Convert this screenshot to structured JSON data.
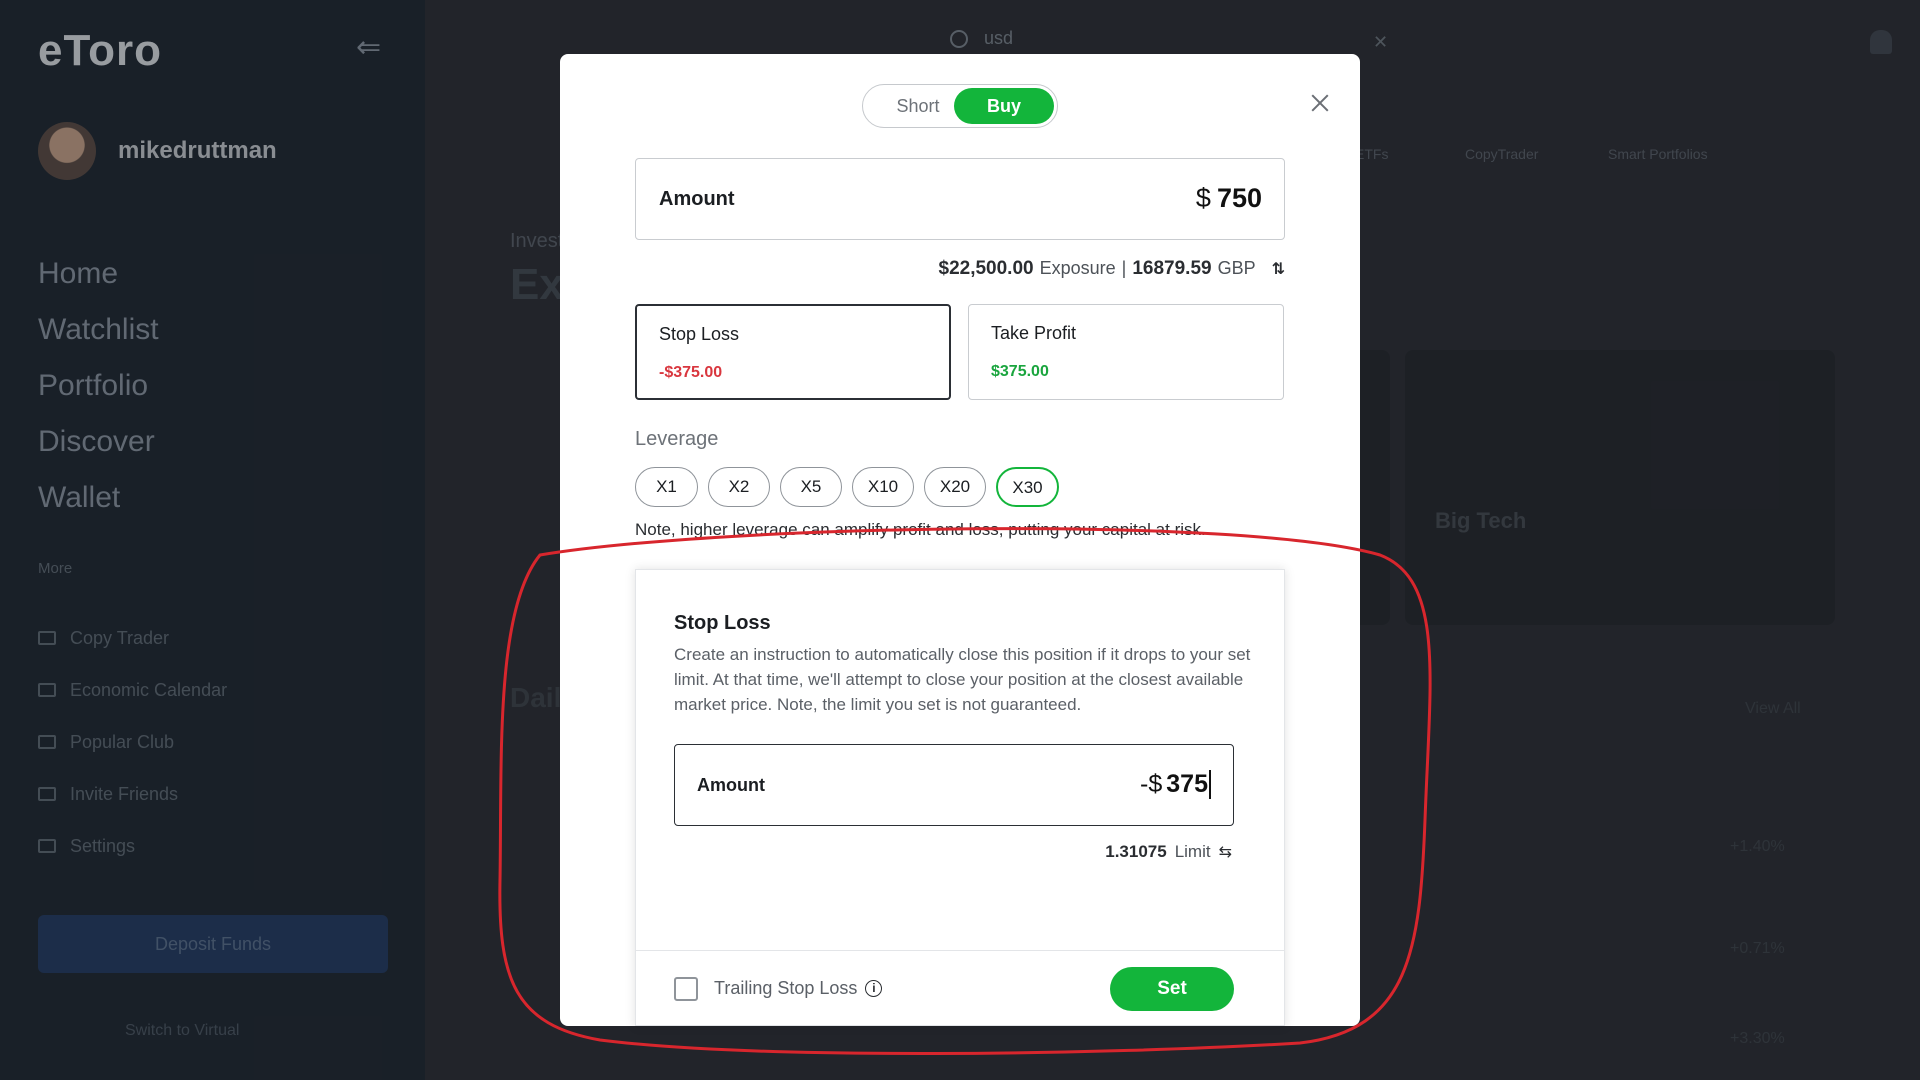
{
  "app": {
    "logo": "eToro",
    "username": "mikedruttman",
    "nav": [
      "Home",
      "Watchlist",
      "Portfolio",
      "Discover",
      "Wallet"
    ],
    "more_label": "More",
    "sub_nav": [
      "Copy Trader",
      "Economic Calendar",
      "Popular Club",
      "Invite Friends",
      "Settings"
    ],
    "deposit_label": "Deposit Funds",
    "footer_label": "Switch to Virtual",
    "search_value": "usd",
    "tabs": [
      "ETFs",
      "CopyTrader",
      "Smart Portfolios"
    ],
    "heading_small": "Investing",
    "heading": "Ex",
    "card_label": "Big Tech",
    "section_label": "Daily",
    "view_all": "View All",
    "row_values": [
      "+1.40%",
      "+0.71%",
      "+3.30%"
    ]
  },
  "trade": {
    "toggle": {
      "short": "Short",
      "buy": "Buy",
      "selected": "Buy"
    },
    "amount": {
      "label": "Amount",
      "currency": "$",
      "value": "750"
    },
    "exposure": {
      "value": "$22,500.00",
      "label": "Exposure",
      "separator": "|",
      "alt_value": "16879.59",
      "alt_currency": "GBP"
    },
    "stop_loss": {
      "label": "Stop Loss",
      "value": "-$375.00"
    },
    "take_profit": {
      "label": "Take Profit",
      "value": "$375.00"
    },
    "leverage": {
      "label": "Leverage",
      "options": [
        "X1",
        "X2",
        "X5",
        "X10",
        "X20",
        "X30"
      ],
      "selected": "X30",
      "note": "Note, higher leverage can amplify profit and loss, putting your capital at risk."
    }
  },
  "sl_panel": {
    "title": "Stop Loss",
    "description": "Create an instruction to automatically close this position if it drops to your set limit. At that time, we'll attempt to close your position at the closest available market price. Note, the limit you set is not guaranteed.",
    "amount_label": "Amount",
    "amount_prefix": "-$",
    "amount_value": "375",
    "limit_value": "1.31075",
    "limit_label": "Limit",
    "trailing_label": "Trailing Stop Loss",
    "trailing_checked": false,
    "set_label": "Set"
  },
  "colors": {
    "buy_green": "#13b53b",
    "loss_red": "#d9363e",
    "annotation_red": "#d8262d"
  }
}
